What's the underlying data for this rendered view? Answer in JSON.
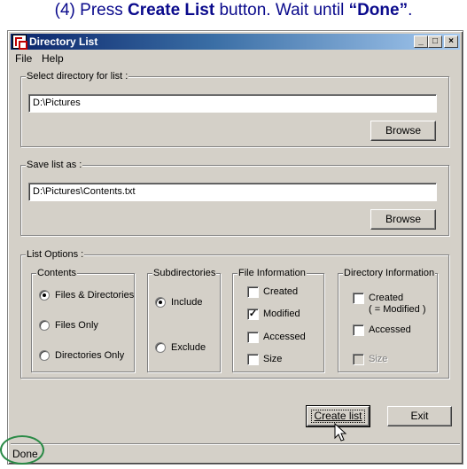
{
  "caption": {
    "prefix": "(4) Press ",
    "emph1": "Create List",
    "middle": " button. Wait until ",
    "emph2": "“Done”",
    "suffix": "."
  },
  "window": {
    "title": "Directory List",
    "controls": {
      "minimize": "_",
      "maximize": "□",
      "close": "×"
    }
  },
  "menu": [
    "File",
    "Help"
  ],
  "select_dir": {
    "label": "Select directory for list :",
    "value": "D:\\Pictures",
    "browse_label": "Browse"
  },
  "save_list": {
    "label": "Save list as :",
    "value": "D:\\Pictures\\Contents.txt",
    "browse_label": "Browse"
  },
  "options": {
    "label": "List Options :",
    "contents": {
      "label": "Contents",
      "items": [
        {
          "label": "Files & Directories",
          "selected": true
        },
        {
          "label": "Files Only",
          "selected": false
        },
        {
          "label": "Directories Only",
          "selected": false
        }
      ]
    },
    "subdirectories": {
      "label": "Subdirectories",
      "items": [
        {
          "label": "Include",
          "selected": true
        },
        {
          "label": "Exclude",
          "selected": false
        }
      ]
    },
    "file_info": {
      "label": "File Information",
      "items": [
        {
          "label": "Created",
          "checked": false
        },
        {
          "label": "Modified",
          "checked": true
        },
        {
          "label": "Accessed",
          "checked": false
        },
        {
          "label": "Size",
          "checked": false
        }
      ]
    },
    "dir_info": {
      "label": "Directory Information",
      "created_line1": "Created",
      "created_line2": "( = Modified )",
      "accessed": "Accessed",
      "size": "Size"
    }
  },
  "buttons": {
    "create": "Create list",
    "exit": "Exit"
  },
  "status": "Done",
  "colors": {
    "caption": "#0a0a8c",
    "highlight_circle": "#2a8a46",
    "face": "#d4d0c8"
  }
}
